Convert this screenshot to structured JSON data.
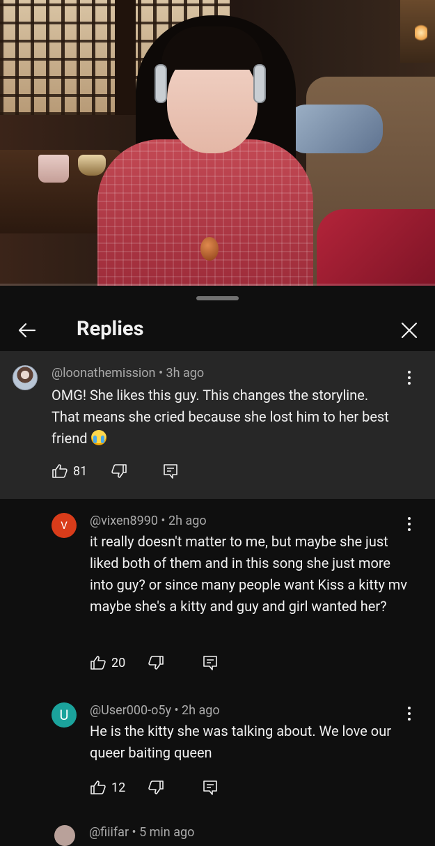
{
  "panel": {
    "title": "Replies"
  },
  "colors": {
    "parent_bg": "#272727",
    "panel_bg": "#0f0f0f",
    "avatar_v": "#d93c1a",
    "avatar_u": "#1ba39c",
    "meta": "#aaaaaa"
  },
  "parent_comment": {
    "author": "@loonathemission",
    "time": "3h ago",
    "text": "OMG! She likes this guy. This changes the storyline. That means she cried because she lost him to her best friend",
    "emoji": "loudly-crying-face",
    "likes": "81"
  },
  "replies": [
    {
      "avatar_letter": "V",
      "author": "@vixen8990",
      "time": "2h ago",
      "text": "it really doesn't matter to me, but maybe she just liked both of them and in this song she just more into guy? or since many people want Kiss a kitty mv maybe she's a kitty and guy and girl wanted her?",
      "likes": "20"
    },
    {
      "avatar_letter": "U",
      "author": "@User000-o5y",
      "time": "2h ago",
      "text": "He is the kitty she was talking about. We love our queer baiting queen",
      "likes": "12"
    }
  ],
  "next_reply_peek": {
    "author": "@fiiifar",
    "time": "5 min ago"
  },
  "icons": [
    "back-arrow-icon",
    "close-icon",
    "more-vert-icon",
    "thumb-up-icon",
    "thumb-down-icon",
    "reply-icon"
  ]
}
